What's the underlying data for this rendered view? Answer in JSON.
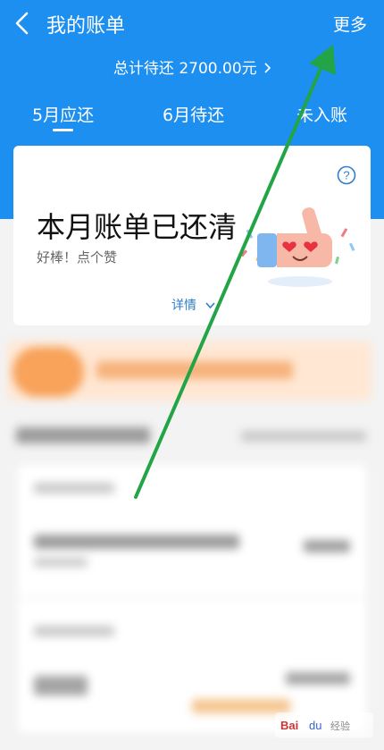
{
  "header": {
    "title": "我的账单",
    "more_label": "更多",
    "summary_label": "总计待还 2700.00元",
    "tabs": [
      {
        "label": "5月应还"
      },
      {
        "label": "6月待还"
      },
      {
        "label": "未入账"
      }
    ]
  },
  "card": {
    "title": "本月账单已还清",
    "subtitle": "好棒！点个赞",
    "details_label": "详情"
  },
  "colors": {
    "header_blue": "#1c8ff0",
    "accent_link": "#2f7ec9",
    "arrow_green": "#22a447"
  },
  "icons": [
    "back-icon",
    "help-icon",
    "chevron-right-icon",
    "chevron-down-icon",
    "thumbs-up-illustration"
  ]
}
